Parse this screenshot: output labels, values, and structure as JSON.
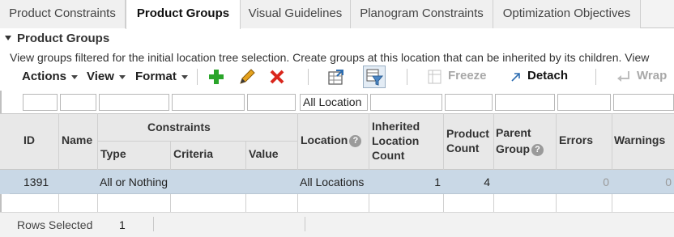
{
  "tabs": [
    {
      "label": "Product Constraints",
      "active": false
    },
    {
      "label": "Product Groups",
      "active": true
    },
    {
      "label": "Visual Guidelines",
      "active": false
    },
    {
      "label": "Planogram Constraints",
      "active": false
    },
    {
      "label": "Optimization Objectives",
      "active": false
    }
  ],
  "panel": {
    "title": "Product Groups",
    "description": "View groups filtered for the initial location tree selection. Create groups at this location that can be inherited by its children. View"
  },
  "toolbar": {
    "actions_label": "Actions",
    "view_label": "View",
    "format_label": "Format",
    "freeze_label": "Freeze",
    "detach_label": "Detach",
    "wrap_label": "Wrap"
  },
  "filters": {
    "location_value": "All Location"
  },
  "columns": {
    "id": "ID",
    "name": "Name",
    "constraints_group": "Constraints",
    "type": "Type",
    "criteria": "Criteria",
    "value": "Value",
    "location": "Location",
    "inherited_line1": "Inherited",
    "inherited_line2": "Location",
    "inherited_line3": "Count",
    "product_count_line1": "Product",
    "product_count_line2": "Count",
    "parent_group_line1": "Parent",
    "parent_group_line2": "Group",
    "errors": "Errors",
    "warnings": "Warnings"
  },
  "rows": [
    {
      "id": "1391",
      "name": "",
      "type": "All or Nothing",
      "criteria": "",
      "value": "",
      "location": "All Locations",
      "inherited_location_count": "1",
      "product_count": "4",
      "parent_group": "",
      "errors": "0",
      "warnings": "0"
    }
  ],
  "status": {
    "rows_selected_label": "Rows Selected",
    "rows_selected_value": "1"
  },
  "colors": {
    "selected_row": "#c9d8e6",
    "header_bg": "#e8e8e8",
    "add_icon": "#2aa52a",
    "delete_icon": "#d9261c"
  }
}
